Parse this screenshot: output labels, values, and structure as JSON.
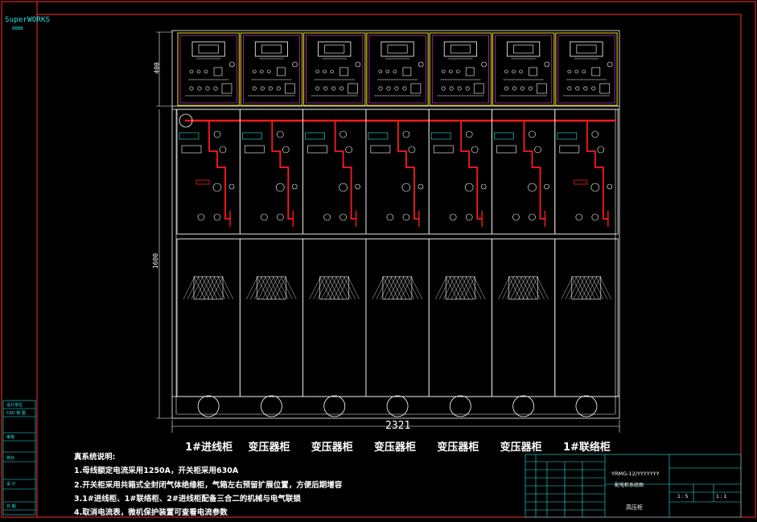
{
  "app": {
    "brand": "SuperWORKS",
    "brand_sub": "BBBB"
  },
  "drawing": {
    "overall_width_dim": "2321",
    "height_dim_top": "400",
    "height_dim_main": "1600",
    "cabinets": [
      {
        "label": "1#进线柜"
      },
      {
        "label": "变压器柜"
      },
      {
        "label": "变压器柜"
      },
      {
        "label": "变压器柜"
      },
      {
        "label": "变压器柜"
      },
      {
        "label": "变压器柜"
      },
      {
        "label": "1#联络柜"
      }
    ],
    "notes_title": "真系统说明:",
    "notes": [
      "1.母线额定电流采用1250A，开关柜采用630A",
      "2.开关柜采用共箱式全封闭气体绝缘柜，气箱左右预留扩展位置，方便后期增容",
      "3.1#进线柜、1#联络柜、2#进线柜配备三合二的机械与电气联锁",
      "4.取消电流表，微机保护装置可查看电流参数"
    ]
  },
  "left_panel": {
    "items": [
      "设计单位",
      "CAD 制 图",
      "审核",
      "校对",
      "设 计",
      "日 期"
    ]
  },
  "title_block": {
    "model": "YRMG-12/YYYYYYY",
    "subtitle": "配电柜系统图",
    "drawing_name": "高压柜",
    "scale_label": "1 : 5",
    "sheet_label": "1 : 1"
  },
  "colors": {
    "frame": "#ff2b2b",
    "outline": "#ffffff",
    "busbar": "#ff1a1a",
    "cyan": "#21e8e8",
    "yellow": "#e6e020",
    "magenta": "#ff40ff",
    "green": "#20e820"
  }
}
